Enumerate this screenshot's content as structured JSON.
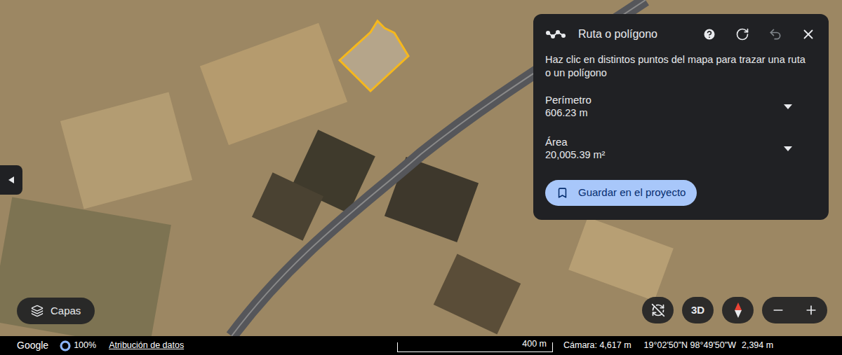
{
  "measure_panel": {
    "title": "Ruta o polígono",
    "description": "Haz clic en distintos puntos del mapa para trazar una ruta o un polígono",
    "actions": [
      {
        "kind": "help",
        "disabled": false
      },
      {
        "kind": "refresh",
        "disabled": false
      },
      {
        "kind": "undo",
        "disabled": true
      },
      {
        "kind": "close",
        "disabled": false
      }
    ],
    "metrics": [
      {
        "label": "Perímetro",
        "value": "606.23 m"
      },
      {
        "label": "Área",
        "value": "20,005.39 m²"
      }
    ],
    "save_button": "Guardar en el proyecto"
  },
  "layers_button": "Capas",
  "map_controls": {
    "view_3d": "3D"
  },
  "status_bar": {
    "logo": "Google",
    "loading": {
      "label": "100%",
      "level": 1
    },
    "attribution": "Atribución de datos",
    "scale": "400 m",
    "camera": "Cámara: 4,617 m",
    "coordinates": "19°02'50\"N 98°49'50\"W",
    "elevation": "2,394 m"
  }
}
